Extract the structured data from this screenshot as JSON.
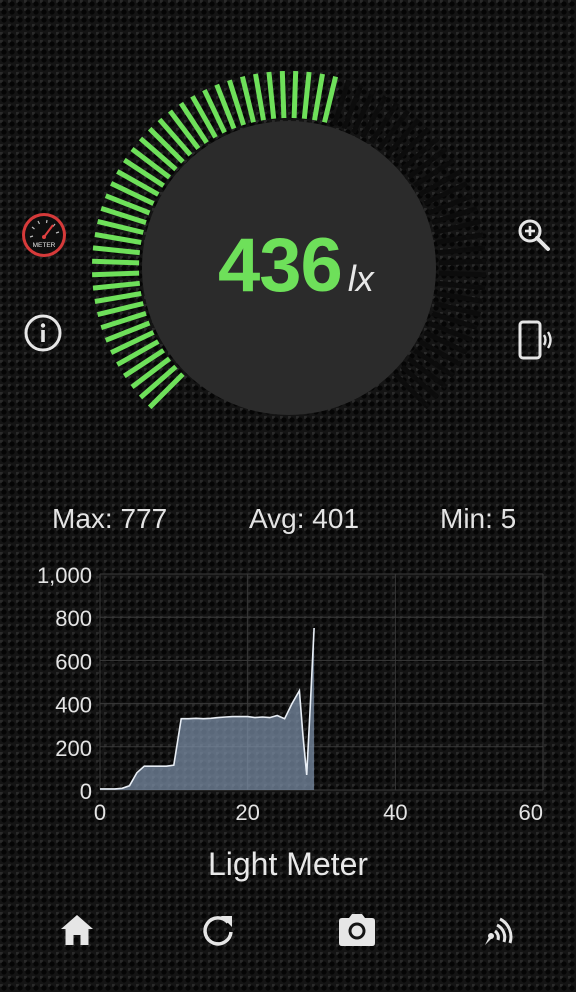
{
  "meter": {
    "value": "436",
    "unit": "lx",
    "level_fraction": 0.56,
    "active_color": "#6ee05a",
    "inactive_color": "#0c0c0c"
  },
  "stats": {
    "max": "Max: 777",
    "avg": "Avg: 401",
    "min": "Min: 5"
  },
  "chart_data": {
    "type": "area",
    "title": "",
    "xlabel": "",
    "ylabel": "",
    "xlim": [
      0,
      60
    ],
    "ylim": [
      0,
      1000
    ],
    "x_ticks": [
      "0",
      "20",
      "40",
      "60"
    ],
    "y_ticks": [
      "0",
      "200",
      "400",
      "600",
      "800",
      "1,000"
    ],
    "grid": true,
    "series": [
      {
        "x": [
          0,
          1,
          2,
          3,
          4,
          5,
          6,
          7,
          8,
          9,
          10,
          11,
          12,
          13,
          14,
          15,
          16,
          17,
          18,
          19,
          20,
          21,
          22,
          23,
          24,
          25,
          26,
          27,
          27.5,
          28,
          28.5,
          29
        ],
        "y": [
          5,
          5,
          5,
          8,
          20,
          80,
          110,
          110,
          110,
          110,
          115,
          330,
          330,
          332,
          330,
          332,
          335,
          338,
          340,
          340,
          340,
          335,
          338,
          335,
          345,
          330,
          400,
          460,
          250,
          70,
          400,
          750
        ]
      }
    ],
    "line_color": "#e8eef5",
    "fill_color": "#7f93ad"
  },
  "app": {
    "title": "Light Meter"
  },
  "icons": {
    "meter_logo": "meter-logo-icon",
    "meter_logo_text": "METER",
    "info": "info-icon",
    "zoom": "zoom-in-icon",
    "vibrate": "phone-vibrate-icon"
  },
  "bottom_nav": {
    "home": "home-icon",
    "refresh": "refresh-icon",
    "camera": "camera-icon",
    "signal": "signal-icon"
  }
}
